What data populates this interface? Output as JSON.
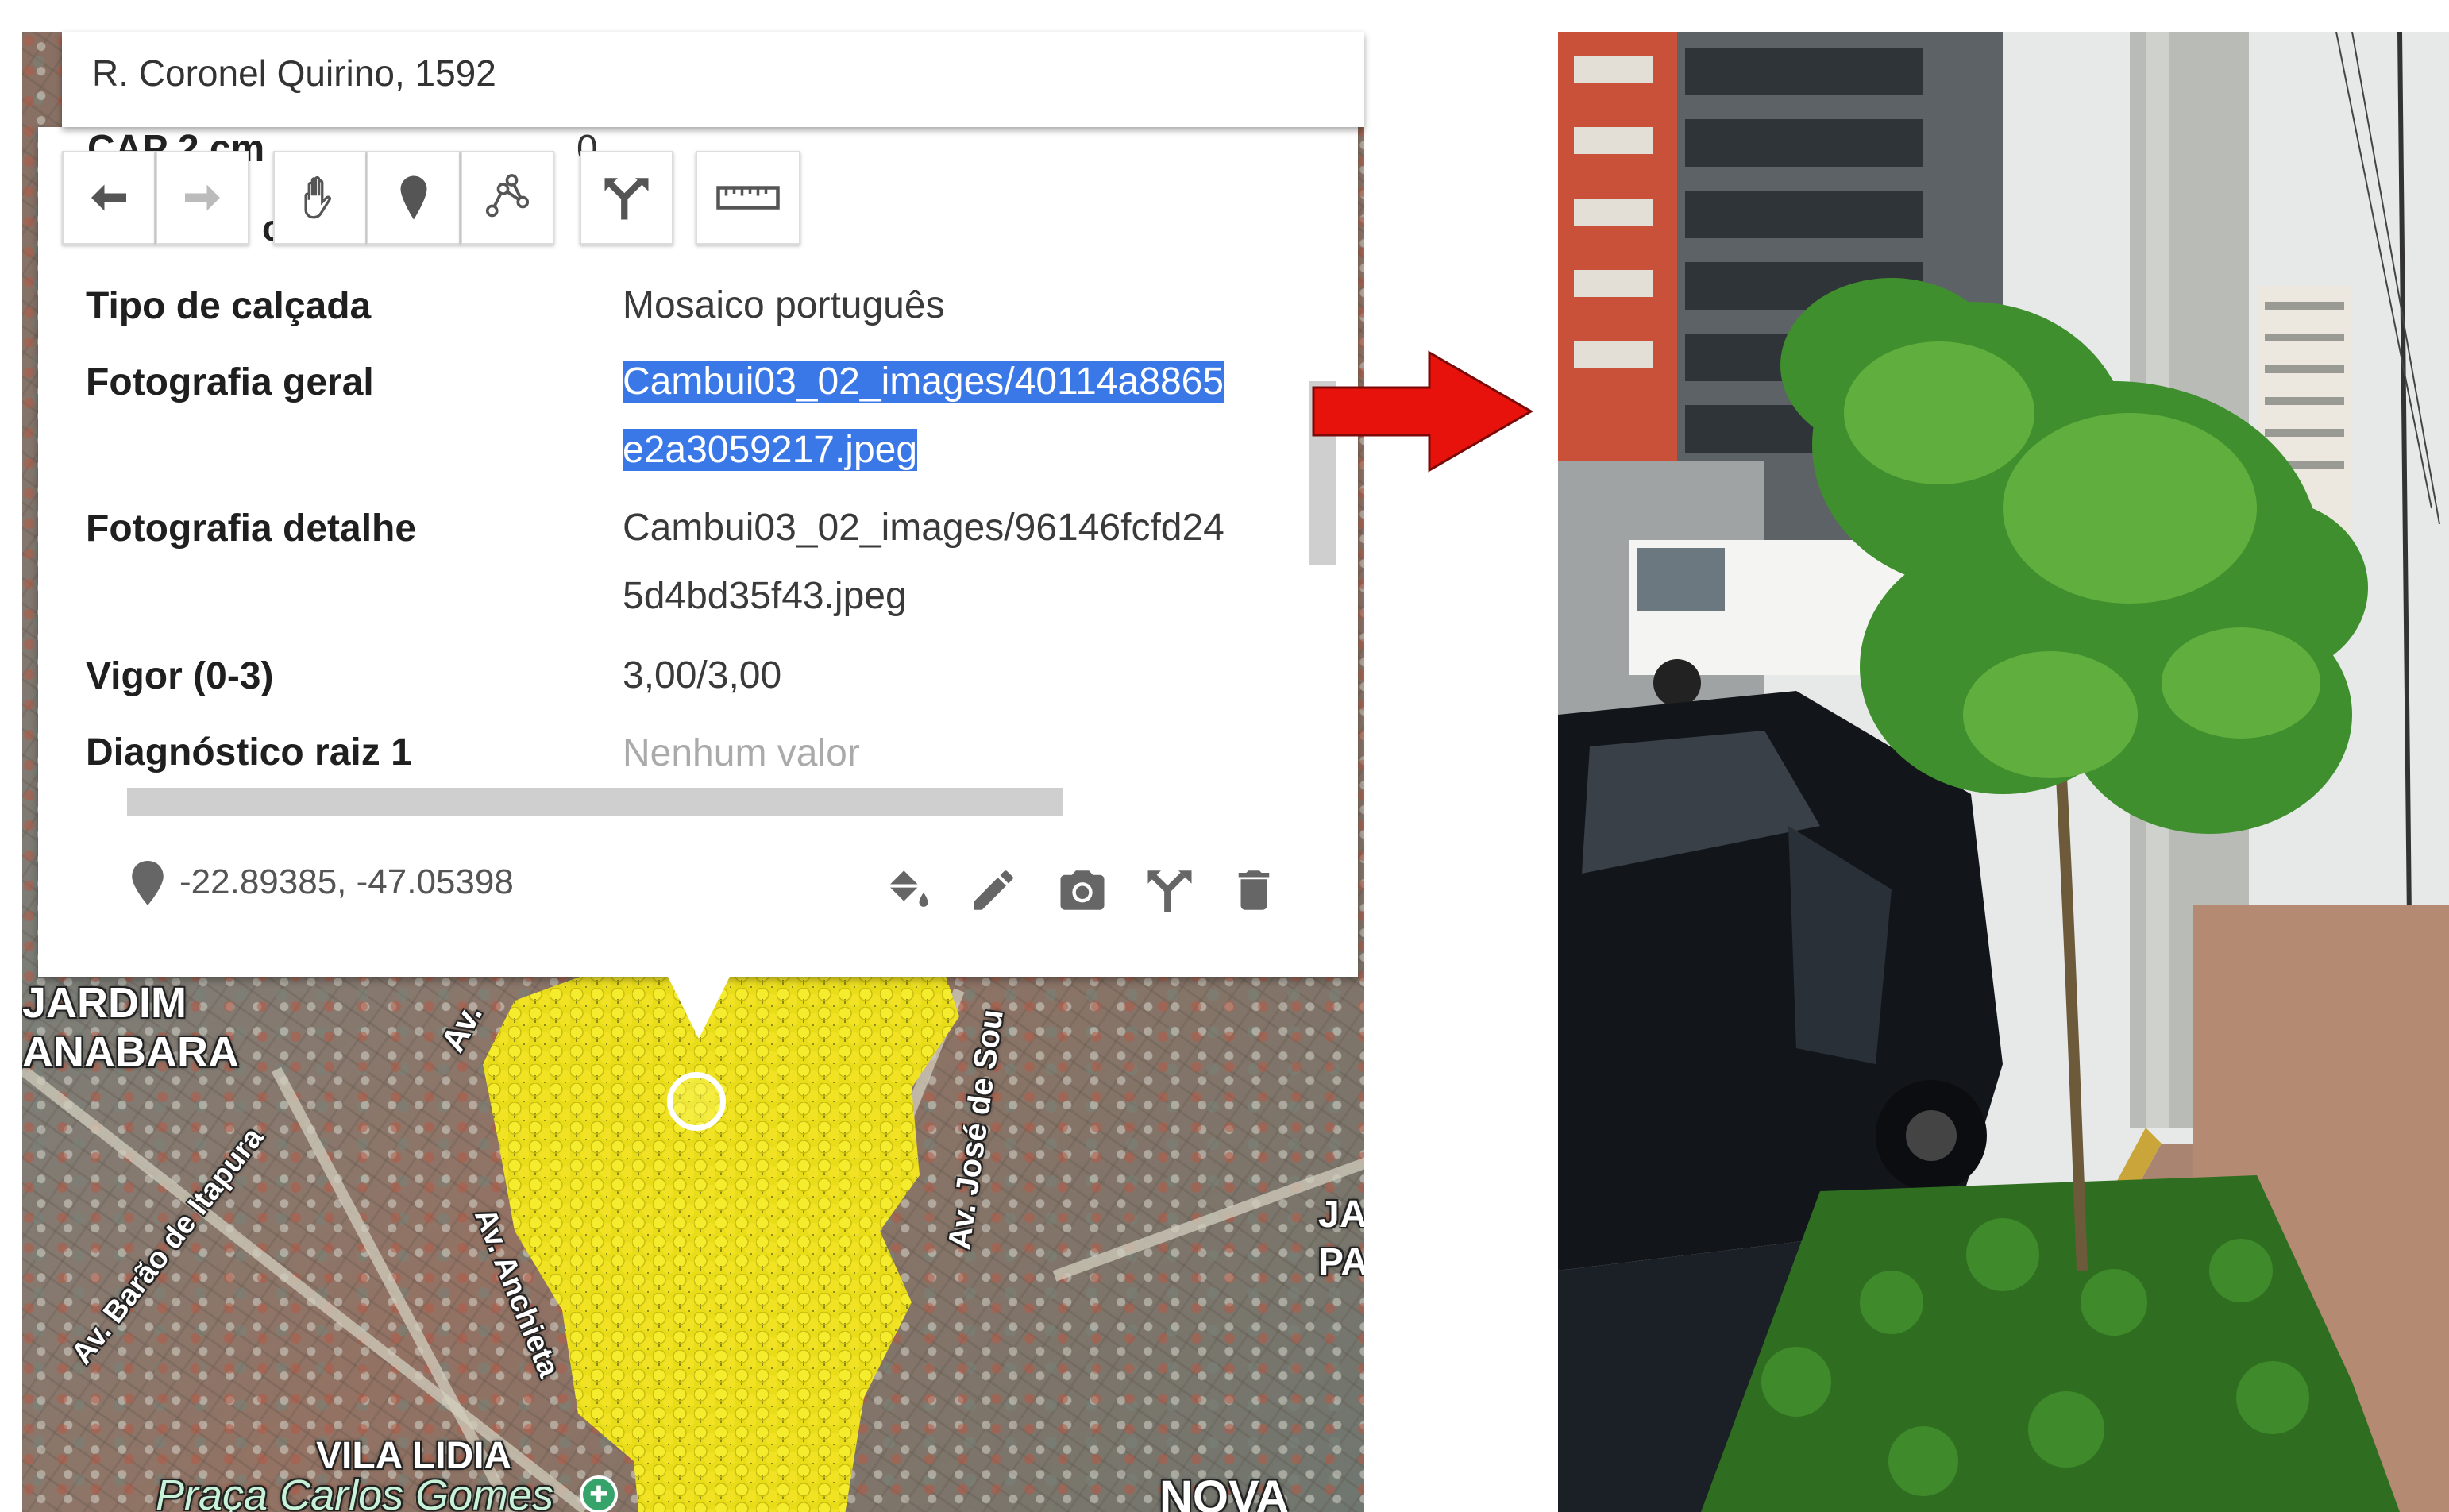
{
  "address_bar": {
    "text": "R. Coronel Quirino, 1592"
  },
  "popup": {
    "hidden_row": {
      "label": "CAP 2 cm",
      "value": "0"
    },
    "partial_letter": "c",
    "toolbar": [
      {
        "name": "undo-button",
        "icon": "undo-icon"
      },
      {
        "name": "redo-button",
        "icon": "redo-icon"
      },
      {
        "name": "pan-button",
        "icon": "hand-icon"
      },
      {
        "name": "add-marker-button",
        "icon": "marker-icon"
      },
      {
        "name": "draw-line-button",
        "icon": "polyline-icon"
      },
      {
        "name": "directions-button",
        "icon": "directions-icon"
      },
      {
        "name": "measure-button",
        "icon": "ruler-icon"
      }
    ],
    "rows": [
      {
        "label": "Tipo de calçada",
        "value": "Mosaico português"
      },
      {
        "label": "Fotografia geral",
        "value_line1": "Cambui03_02_images/40114a8865",
        "value_line2": "e2a3059217.jpeg",
        "selected": true
      },
      {
        "label": "Fotografia detalhe",
        "value_line1": "Cambui03_02_images/96146fcfd24",
        "value_line2": "5d4bd35f43.jpeg"
      },
      {
        "label": "Vigor (0-3)",
        "value": "3,00/3,00"
      },
      {
        "label": "Diagnóstico raiz 1",
        "value": "Nenhum valor",
        "empty": true
      }
    ],
    "coordinates": "-22.89385, -47.05398",
    "actions": [
      "style-icon",
      "edit-icon",
      "camera-icon",
      "directions-icon",
      "delete-icon"
    ]
  },
  "map_labels": {
    "jardim": "JARDIM",
    "anabara": "ANABARA",
    "av_top": "Av.",
    "av_jose_de_sou": "Av. José de Sou",
    "av_barao": "Av. Barão de Itapura",
    "av_anchieta": "Av. Anchieta",
    "ja": "JA",
    "pa": "PA",
    "vila_lidia": "VILA LIDIA",
    "praca": "Praça Carlos Gomes",
    "nova": "NOVA"
  },
  "colors": {
    "selection": "#3b78e7",
    "arrow": "#e8120c",
    "tree_marker": "#f2e428"
  }
}
